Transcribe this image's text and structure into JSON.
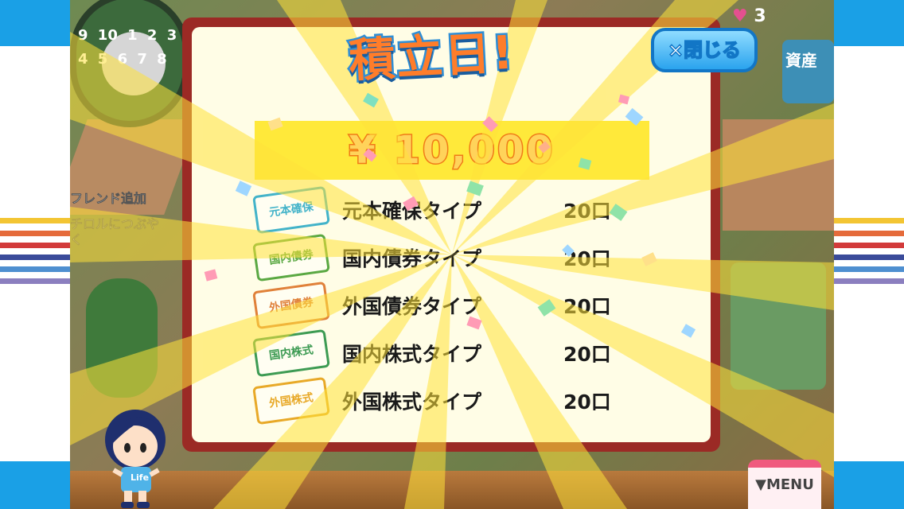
{
  "dialog": {
    "title": "積立日!",
    "close_label": "×閉じる",
    "amount": "¥ 10,000",
    "rows": [
      {
        "badge": "元本確保",
        "label": "元本確保タイプ",
        "count": "20口",
        "color": "#43b3c9"
      },
      {
        "badge": "国内債券",
        "label": "国内債券タイプ",
        "count": "20口",
        "color": "#5aa842"
      },
      {
        "badge": "外国債券",
        "label": "外国債券タイプ",
        "count": "20口",
        "color": "#e0813a"
      },
      {
        "badge": "国内株式",
        "label": "国内株式タイプ",
        "count": "20口",
        "color": "#3d9b53"
      },
      {
        "badge": "外国株式",
        "label": "外国株式タイプ",
        "count": "20口",
        "color": "#e8a928"
      }
    ]
  },
  "side_menu": {
    "friend_add": "フレンド追加",
    "tweet": "チロルにつぶやく"
  },
  "background_badge": "資産",
  "roulette_numbers": "9 10 1 2 3 4 5 6 7 8",
  "status": {
    "hearts": "3"
  },
  "menu_button": "▼MENU",
  "character_shirt": "Life",
  "colors": {
    "accent_blue": "#1aa0e6",
    "dialog_frame": "#9b2a25",
    "title_orange": "#ff7d2a",
    "menu_pink": "#f05a7e"
  }
}
